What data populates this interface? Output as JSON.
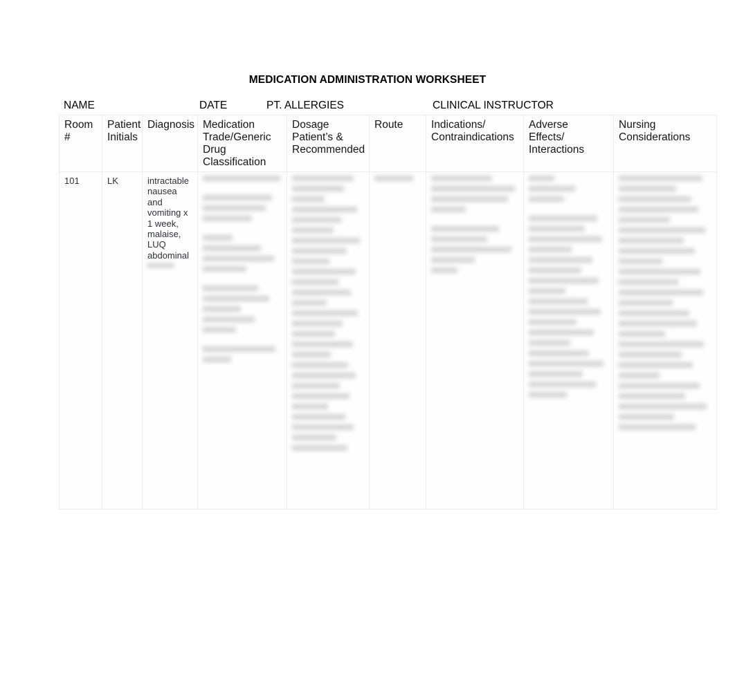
{
  "document": {
    "title": "MEDICATION ADMINISTRATION WORKSHEET"
  },
  "form_fields": {
    "name_label": "NAME",
    "date_label": "DATE",
    "allergies_label": "PT. ALLERGIES",
    "instructor_label": "CLINICAL INSTRUCTOR",
    "name_value": "",
    "date_value": "",
    "allergies_value": "",
    "instructor_value": ""
  },
  "table": {
    "headers": [
      "Room #",
      "Patient Initials",
      "Diagnosis",
      "Medication Trade/Generic Drug Classification",
      "Dosage Patient’s & Recommended",
      "Route",
      "Indications/ Contraindications",
      "Adverse Effects/ Interactions",
      "Nursing Considerations"
    ],
    "header_lines": {
      "room": [
        "Room",
        "#"
      ],
      "initials": [
        "Patient",
        "Initials"
      ],
      "diagnosis": [
        "Diagnosis"
      ],
      "medication": [
        "Medication",
        "Trade/Generic",
        "Drug",
        "Classification"
      ],
      "dosage": [
        "Dosage",
        "Patient’s &",
        "Recommended"
      ],
      "route": [
        "Route"
      ],
      "indications": [
        "Indications/",
        "Contraindications"
      ],
      "adverse": [
        "Adverse",
        "Effects/",
        "Interactions"
      ],
      "nursing": [
        "Nursing",
        "Considerations"
      ]
    },
    "rows": [
      {
        "room": "101",
        "initials": "LK",
        "diagnosis": "intractable nausea and vomiting x 1 week, malaise, LUQ abdominal",
        "diagnosis_redacted": true,
        "medication": "",
        "medication_redacted": true,
        "dosage": "",
        "dosage_redacted": true,
        "route": "",
        "route_redacted": true,
        "indications": "",
        "indications_redacted": true,
        "adverse": "",
        "adverse_redacted": true,
        "nursing": "",
        "nursing_redacted": true
      }
    ]
  },
  "colors": {
    "page_background": "#ffffff",
    "table_border": "#ececed",
    "title_text": "#000000",
    "body_text": "#2b3138",
    "redacted_block": "#b9bbbe"
  }
}
